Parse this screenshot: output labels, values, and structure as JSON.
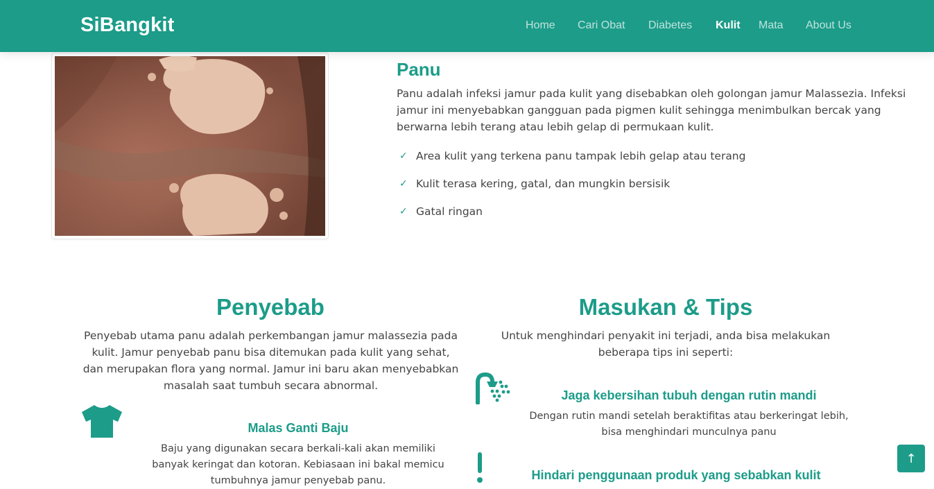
{
  "brand": {
    "name": "SiBangkit",
    "color": "#1c9c89"
  },
  "nav": {
    "items": [
      {
        "label": "Home",
        "active": false
      },
      {
        "label": "Cari Obat",
        "active": false
      },
      {
        "label": "Diabetes",
        "active": false
      },
      {
        "label": "Kulit",
        "active": true
      },
      {
        "label": "Mata",
        "active": false
      },
      {
        "label": "About Us",
        "active": false
      }
    ]
  },
  "panu": {
    "title": "Panu",
    "description": "Panu adalah infeksi jamur pada kulit yang disebabkan oleh golongan jamur Malassezia. Infeksi jamur ini menyebabkan gangguan pada pigmen kulit sehingga menimbulkan bercak yang berwarna lebih terang atau lebih gelap di permukaan kulit.",
    "symptoms": [
      "Area kulit yang terkena panu tampak lebih gelap atau terang",
      "Kulit terasa kering, gatal, dan mungkin bersisik",
      "Gatal ringan"
    ]
  },
  "penyebab": {
    "title": "Penyebab",
    "description": "Penyebab utama panu adalah perkembangan jamur malassezia pada kulit. Jamur penyebab panu bisa ditemukan pada kulit yang sehat, dan merupakan flora yang normal. Jamur ini baru akan menyebabkan masalah saat tumbuh secara abnormal.",
    "items": [
      {
        "icon": "tshirt-icon",
        "title": "Malas Ganti Baju",
        "description": "Baju yang digunakan secara berkali-kali akan memiliki banyak keringat dan kotoran. Kebiasaan ini bakal memicu tumbuhnya jamur penyebab panu."
      }
    ]
  },
  "tips": {
    "title": "Masukan & Tips",
    "description": "Untuk menghindari penyakit ini terjadi, anda bisa melakukan beberapa tips ini seperti:",
    "items": [
      {
        "icon": "shower-icon",
        "title": "Jaga kebersihan tubuh dengan rutin mandi",
        "description": "Dengan rutin mandi setelah beraktifitas atau berkeringat lebih, bisa menghindari munculnya panu"
      },
      {
        "icon": "exclamation-icon",
        "title": "Hindari penggunaan produk yang sebabkan kulit"
      }
    ]
  },
  "back_to_top": {
    "icon": "arrow-up-icon",
    "symbol": "↑"
  }
}
